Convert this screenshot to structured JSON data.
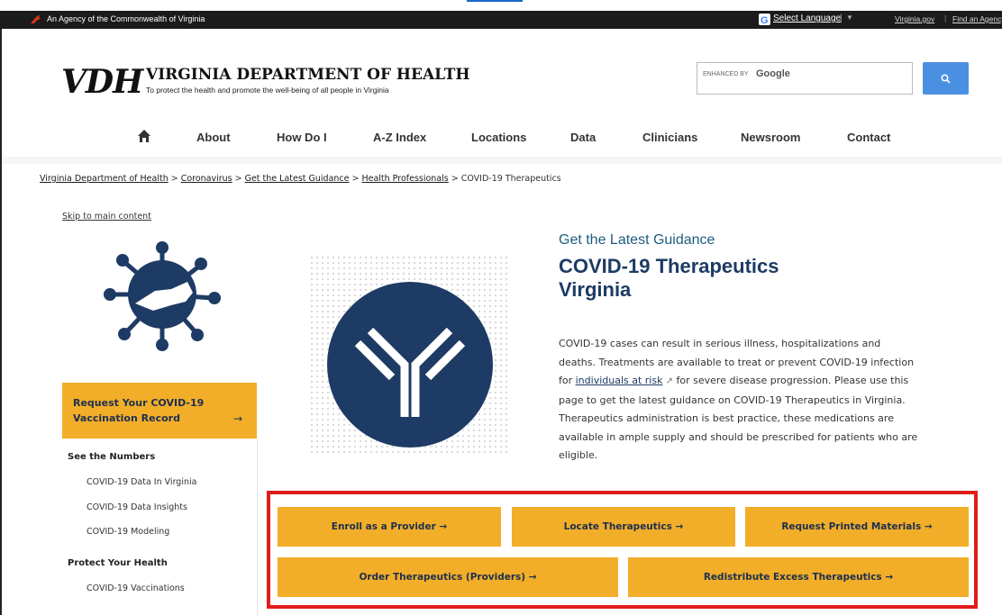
{
  "agency_bar": {
    "agency_text": "An Agency of the Commonwealth of Virginia",
    "select_language": "Select Language",
    "separator": "|",
    "virginia_gov": "Virginia.gov",
    "find_agency": "Find an Agency"
  },
  "header": {
    "logo_abbr": "VDH",
    "logo_title": "VIRGINIA DEPARTMENT OF HEALTH",
    "logo_tagline": "To protect the health and promote the well-being of all people in Virginia",
    "search_enhanced": "ENHANCED BY",
    "search_google": "Google"
  },
  "nav": {
    "items": [
      "About",
      "How Do I",
      "A-Z Index",
      "Locations",
      "Data",
      "Clinicians",
      "Newsroom",
      "Contact"
    ]
  },
  "breadcrumb": {
    "items": [
      "Virginia Department of Health",
      "Coronavirus",
      "Get the Latest Guidance",
      "Health Professionals"
    ],
    "current": "COVID-19 Therapeutics"
  },
  "skip_link": "Skip to main content",
  "sidebar": {
    "request_card": "Request Your COVID-19 Vaccination Record",
    "request_arrow": "→",
    "sections": [
      {
        "heading": "See the Numbers",
        "items": [
          "COVID-19 Data In Virginia",
          "COVID-19 Data Insights",
          "COVID-19 Modeling"
        ]
      },
      {
        "heading": "Protect Your Health",
        "items": [
          "COVID-19 Vaccinations"
        ]
      }
    ]
  },
  "hero": {
    "subtitle": "Get the Latest Guidance",
    "title_line1": "COVID-19 Therapeutics",
    "title_line2": "Virginia",
    "para_before": "COVID-19 cases can result in serious illness, hospitalizations and deaths. Treatments are available to treat or prevent COVID-19 infection for ",
    "para_link": "individuals at risk",
    "para_after": " for severe disease progression. Please use this page to get the latest guidance on COVID-19 Therapeutics in Virginia. Therapeutics administration is best practice, these medications are available in ample supply and should be prescribed for patients who are eligible."
  },
  "buttons": {
    "enroll": "Enroll as a Provider →",
    "locate": "Locate Therapeutics →",
    "request_printed": "Request Printed Materials →",
    "order": "Order Therapeutics (Providers) →",
    "redistribute": "Redistribute Excess Therapeutics →"
  },
  "colors": {
    "accent_gold": "#f2ae29",
    "navy": "#1d3b64",
    "highlight_red": "#e11b1b",
    "search_blue": "#4a90e2"
  }
}
